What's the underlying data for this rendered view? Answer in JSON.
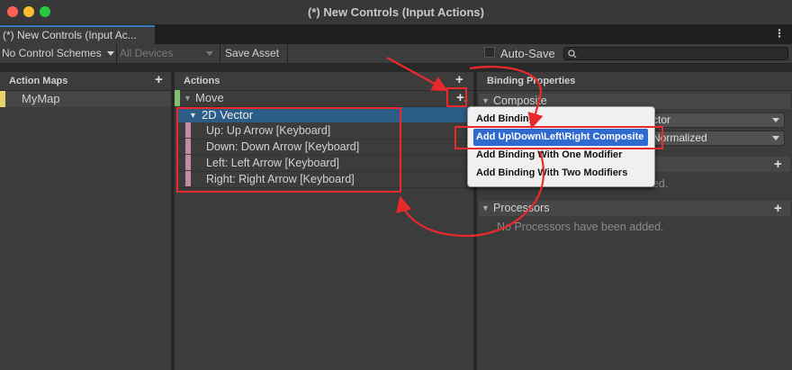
{
  "window": {
    "title": "(*) New Controls (Input Actions)"
  },
  "tab": {
    "label": "(*) New Controls (Input Ac..."
  },
  "toolbar": {
    "control_schemes": "No Control Schemes",
    "devices": "All Devices",
    "save_asset": "Save Asset",
    "auto_save": "Auto-Save",
    "search_value": ""
  },
  "action_maps": {
    "header": "Action Maps",
    "items": [
      {
        "label": "MyMap"
      }
    ]
  },
  "actions": {
    "header": "Actions",
    "action": "Move",
    "composite": "2D Vector",
    "bindings": [
      {
        "label": "Up: Up Arrow [Keyboard]"
      },
      {
        "label": "Down: Down Arrow [Keyboard]"
      },
      {
        "label": "Left: Left Arrow [Keyboard]"
      },
      {
        "label": "Right: Right Arrow [Keyboard]"
      }
    ]
  },
  "binding_properties": {
    "header": "Binding Properties",
    "composite_section": "Composite",
    "composite_type_value": "ctor",
    "mode_value": "Normalized",
    "interactions_empty": "ded.",
    "processors_section": "Processors",
    "processors_empty": "No Processors have been added."
  },
  "menu": {
    "items": [
      {
        "label": "Add Binding"
      },
      {
        "label": "Add Up\\Down\\Left\\Right Composite"
      },
      {
        "label": "Add Binding With One Modifier"
      },
      {
        "label": "Add Binding With Two Modifiers"
      }
    ]
  },
  "colors": {
    "selection": "#2c5d87",
    "menu_highlight": "#2f6ad0",
    "annotation_red": "#e82a2a",
    "action_green": "#7fbf6e",
    "binding_pink": "#c58aa8",
    "map_yellow": "#e7d36b"
  }
}
